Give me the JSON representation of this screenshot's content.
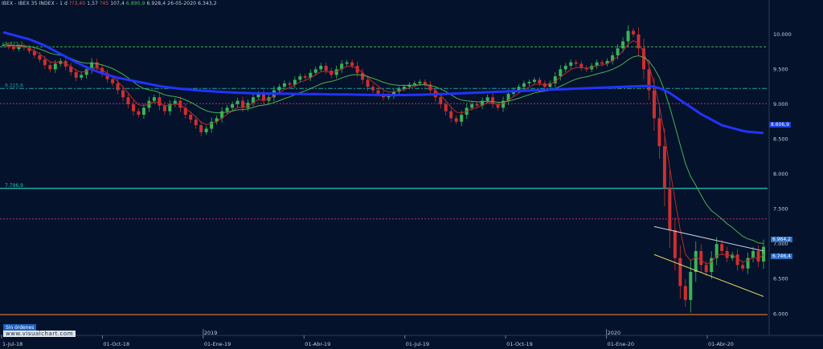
{
  "header": {
    "symbol": "IBEX - IBEX 35 INDEX",
    "timeframe": "1 d",
    "v1": "??3,40",
    "v2": "1,57",
    "v3": "?45",
    "v4": "107,4",
    "v5": "6.890,9",
    "v6": "6.928,4",
    "date": "26-05-2020",
    "v7": "6.343,2"
  },
  "badge": "Sin órdenes",
  "watermark": "www.visualchart.com",
  "colors": {
    "background": "#04122b",
    "up": "#3ab456",
    "down": "#cc3030",
    "ma_long": "#2233ff",
    "ma_mid": "#4caf50",
    "ma_short": "#c02828",
    "level_cyan": "#1ec9c0"
  },
  "price_labels": {
    "ma_long": "8.606,9",
    "last": "6.964,2",
    "ma_mid": "6.746,4"
  },
  "chart_data": {
    "type": "candlestick",
    "title": "IBEX - IBEX 35 INDEX",
    "x_ticks": [
      "1-Jul-18",
      "01-Oct-18",
      "01-Ene-19",
      "01-Abr-19",
      "01-Jul-19",
      "01-Oct-19",
      "01-Ene-20",
      "01-Abr-20"
    ],
    "year_markers": [
      "2019",
      "2020"
    ],
    "ylim": [
      5900,
      10400
    ],
    "y_ticks": [
      {
        "v": 10000,
        "label": "10.000"
      },
      {
        "v": 9500,
        "label": "9.500"
      },
      {
        "v": 9000,
        "label": "9.000"
      },
      {
        "v": 8500,
        "label": "8.500"
      },
      {
        "v": 8000,
        "label": "8.000"
      },
      {
        "v": 7500,
        "label": "7.500"
      },
      {
        "v": 7000,
        "label": "7.000"
      },
      {
        "v": 6500,
        "label": "6.500"
      },
      {
        "v": 6000,
        "label": "6.000"
      }
    ],
    "levels": [
      {
        "v": 9821.2,
        "label": "9.821,2",
        "color": "#37b24d",
        "style": "dashed"
      },
      {
        "v": 9225.6,
        "label": "9.225,6",
        "color": "#1aa3a3",
        "style": "dashdot"
      },
      {
        "v": 9010,
        "label": "",
        "color": "#c03070",
        "style": "dotted"
      },
      {
        "v": 7796.9,
        "label": "7.796,9",
        "color": "#1ec9c0",
        "style": "solid"
      },
      {
        "v": 7360,
        "label": "",
        "color": "#c03070",
        "style": "dotted"
      },
      {
        "v": 5990,
        "label": "",
        "color": "#d07030",
        "style": "solid"
      }
    ],
    "series": [
      {
        "name": "close",
        "values": [
          9850,
          9820,
          9790,
          9830,
          9810,
          9760,
          9700,
          9640,
          9560,
          9500,
          9580,
          9620,
          9540,
          9460,
          9380,
          9420,
          9500,
          9600,
          9520,
          9440,
          9360,
          9300,
          9200,
          9100,
          9000,
          8900,
          8850,
          8950,
          9050,
          9100,
          8980,
          8900,
          9000,
          9050,
          8950,
          8850,
          8780,
          8700,
          8600,
          8650,
          8750,
          8800,
          8900,
          8950,
          9000,
          9050,
          8950,
          9020,
          9100,
          9150,
          9050,
          9100,
          9200,
          9250,
          9300,
          9280,
          9350,
          9400,
          9380,
          9450,
          9500,
          9550,
          9480,
          9420,
          9500,
          9580,
          9600,
          9550,
          9450,
          9350,
          9250,
          9200,
          9150,
          9100,
          9120,
          9180,
          9220,
          9250,
          9280,
          9300,
          9320,
          9280,
          9200,
          9100,
          9000,
          8900,
          8800,
          8750,
          8850,
          8950,
          9000,
          8980,
          9050,
          9100,
          9000,
          8950,
          9050,
          9150,
          9200,
          9250,
          9300,
          9320,
          9350,
          9300,
          9250,
          9300,
          9400,
          9500,
          9550,
          9600,
          9580,
          9520,
          9500,
          9550,
          9600,
          9580,
          9620,
          9700,
          9800,
          9900,
          10050,
          10000,
          9800,
          9500,
          9200,
          8800,
          8400,
          7800,
          7200,
          6800,
          6400,
          6200,
          6600,
          6900,
          6700,
          6600,
          6800,
          7000,
          6900,
          6800,
          6850,
          6700,
          6650,
          6800,
          6900,
          6750,
          6960
        ]
      },
      {
        "name": "ma_long",
        "values": [
          10030,
          10010,
          9990,
          9970,
          9950,
          9930,
          9900,
          9870,
          9840,
          9800,
          9760,
          9720,
          9680,
          9640,
          9600,
          9565,
          9530,
          9500,
          9470,
          9445,
          9420,
          9400,
          9380,
          9365,
          9350,
          9335,
          9320,
          9305,
          9290,
          9275,
          9260,
          9250,
          9240,
          9230,
          9222,
          9215,
          9208,
          9200,
          9195,
          9190,
          9185,
          9180,
          9176,
          9172,
          9168,
          9165,
          9162,
          9160,
          9158,
          9156,
          9155,
          9154,
          9153,
          9152,
          9151,
          9150,
          9149,
          9148,
          9147,
          9146,
          9145,
          9144,
          9143,
          9142,
          9141,
          9140,
          9139,
          9138,
          9137,
          9136,
          9135,
          9134,
          9133,
          9132,
          9131,
          9130,
          9131,
          9132,
          9133,
          9134,
          9136,
          9138,
          9140,
          9142,
          9145,
          9148,
          9151,
          9154,
          9157,
          9160,
          9163,
          9166,
          9169,
          9172,
          9175,
          9178,
          9181,
          9184,
          9187,
          9190,
          9193,
          9196,
          9199,
          9202,
          9205,
          9208,
          9211,
          9214,
          9217,
          9220,
          9223,
          9226,
          9229,
          9232,
          9235,
          9238,
          9241,
          9244,
          9247,
          9250,
          9253,
          9256,
          9258,
          9260,
          9262,
          9250,
          9230,
          9200,
          9160,
          9110,
          9060,
          9010,
          8960,
          8910,
          8860,
          8820,
          8780,
          8740,
          8700,
          8680,
          8660,
          8640,
          8620,
          8606.9,
          8600,
          8595,
          8590
        ]
      }
    ]
  }
}
